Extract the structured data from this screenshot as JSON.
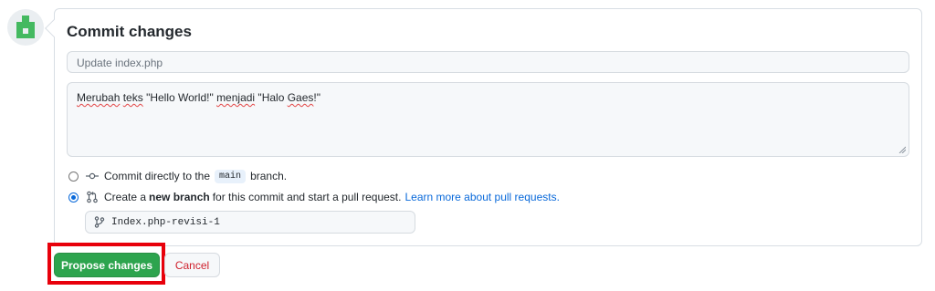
{
  "avatar": {
    "icon": "identicon-avatar",
    "color": "#44b960"
  },
  "commit": {
    "title": "Commit changes",
    "summary_placeholder": "Update index.php",
    "description_parts": [
      {
        "text": "Merubah",
        "squiggle": true
      },
      {
        "text": " ",
        "squiggle": false
      },
      {
        "text": "teks",
        "squiggle": true
      },
      {
        "text": " \"Hello World!\" ",
        "squiggle": false
      },
      {
        "text": "menjadi",
        "squiggle": true
      },
      {
        "text": " \"Halo ",
        "squiggle": false
      },
      {
        "text": "Gaes",
        "squiggle": true
      },
      {
        "text": "!\"",
        "squiggle": false
      }
    ]
  },
  "options": {
    "direct": {
      "icon": "git-commit-icon",
      "prefix": "Commit directly to the",
      "branch": "main",
      "suffix": "branch.",
      "selected": false
    },
    "new_branch": {
      "icon": "git-pull-request-icon",
      "prefix": "Create a",
      "bold": "new branch",
      "suffix": "for this commit and start a pull request.",
      "link": "Learn more about pull requests.",
      "selected": true
    }
  },
  "branch_name": {
    "icon": "git-branch-icon",
    "value": "Index.php-revisi-1"
  },
  "buttons": {
    "propose": "Propose changes",
    "cancel": "Cancel"
  },
  "colors": {
    "primary": "#2da44e",
    "danger": "#cf222e",
    "link": "#0969da",
    "highlight": "#e8000b"
  }
}
